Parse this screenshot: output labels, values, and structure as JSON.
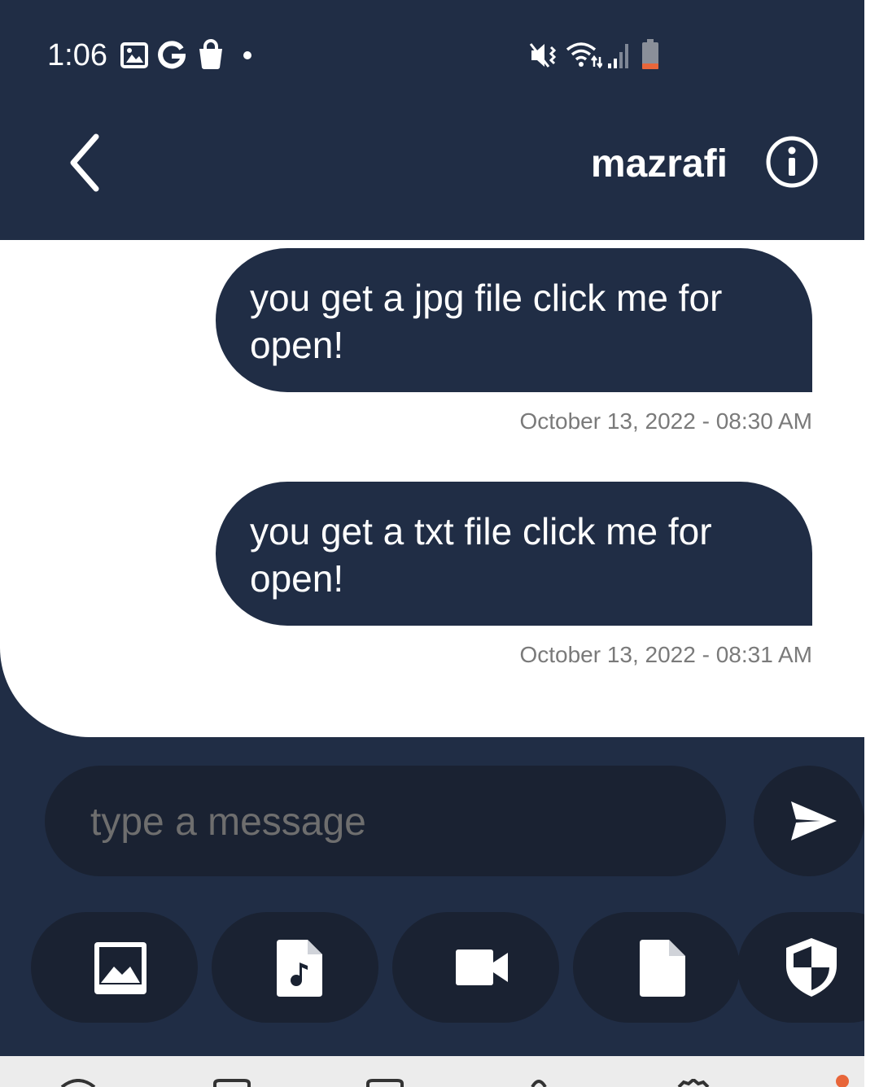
{
  "status_bar": {
    "time": "1:06",
    "icons": [
      "gallery-icon",
      "google-icon",
      "shopping-bag-icon",
      "dot-icon",
      "mute-vibrate-icon",
      "wifi-icon",
      "signal-icon",
      "battery-low-icon"
    ]
  },
  "header": {
    "contact_name": "mazrafi",
    "back_icon": "chevron-left-icon",
    "info_icon": "info-circle-icon"
  },
  "messages": [
    {
      "text": "you get a jpg file click me for open!",
      "timestamp": "October 13, 2022 - 08:30 AM"
    },
    {
      "text": "you get a txt file click me for open!",
      "timestamp": "October 13, 2022 - 08:31 AM"
    }
  ],
  "composer": {
    "placeholder": "type a message",
    "send_icon": "send-icon"
  },
  "attachments": [
    {
      "icon": "image-icon"
    },
    {
      "icon": "audio-file-icon"
    },
    {
      "icon": "video-camera-icon"
    },
    {
      "icon": "document-icon"
    },
    {
      "icon": "shield-icon"
    }
  ],
  "colors": {
    "primary": "#202d45",
    "surface_dark": "#1a2232",
    "background": "#ffffff",
    "battery_accent": "#e8663a"
  }
}
